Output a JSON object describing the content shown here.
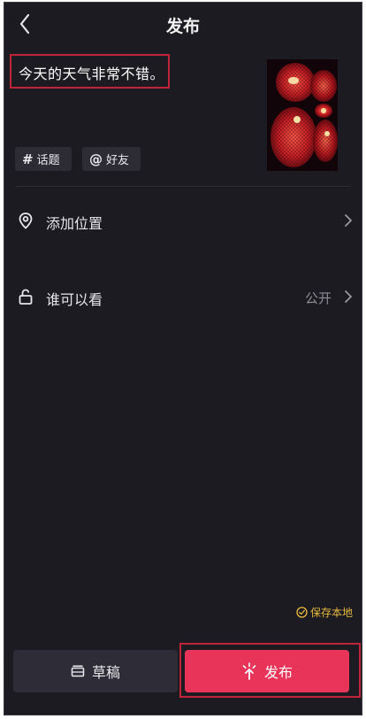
{
  "header": {
    "title": "发布",
    "back_icon": "chevron-left-icon"
  },
  "post": {
    "caption": "今天的天气非常不错。",
    "thumbnail": "red-lanterns-photo"
  },
  "chips": {
    "topic_symbol": "#",
    "topic_label": "话题",
    "friend_symbol": "@",
    "friend_label": "好友"
  },
  "rows": {
    "location": {
      "label": "添加位置",
      "icon": "location-pin-icon"
    },
    "visibility": {
      "label": "谁可以看",
      "value": "公开",
      "icon": "unlock-icon"
    }
  },
  "footer": {
    "save_local_label": "保存本地",
    "draft_label": "草稿",
    "publish_label": "发布"
  },
  "colors": {
    "background": "#1c1b22",
    "publish_button": "#e9345a",
    "highlight_border": "#c0233a",
    "save_local_text": "#e5b93f"
  }
}
